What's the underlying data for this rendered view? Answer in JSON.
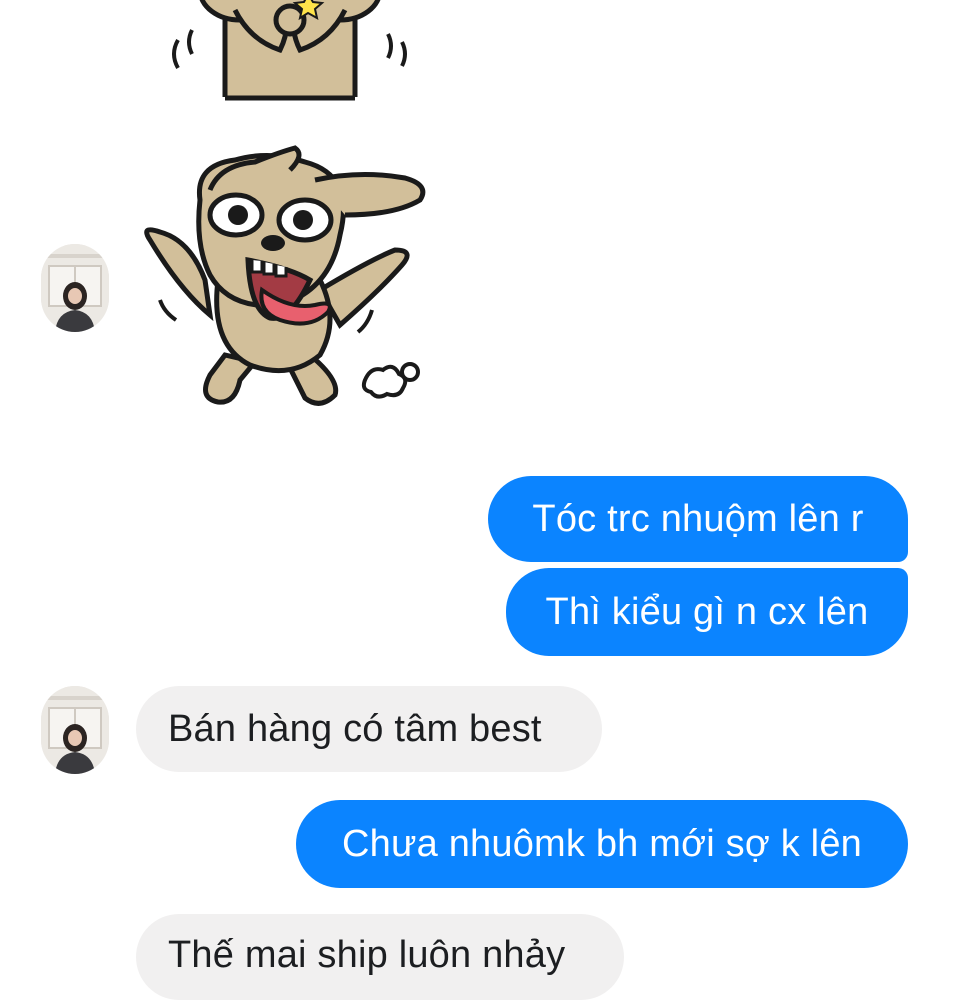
{
  "messages": [
    {
      "id": "m1",
      "direction": "outgoing",
      "text": "Tóc trc nhuộm lên r"
    },
    {
      "id": "m2",
      "direction": "outgoing",
      "text": "Thì kiểu gì n cx lên"
    },
    {
      "id": "m3",
      "direction": "incoming",
      "text": "Bán hàng có tâm best"
    },
    {
      "id": "m4",
      "direction": "outgoing",
      "text": "Chưa nhuômk bh mới sợ k lên"
    },
    {
      "id": "m5",
      "direction": "incoming",
      "text": "Thế mai ship luôn nhảy"
    }
  ],
  "stickers": [
    {
      "id": "s1",
      "icon": "dog-sticker-clasping-hands-icon"
    },
    {
      "id": "s2",
      "icon": "dog-sticker-running-tongue-out-icon"
    }
  ],
  "colors": {
    "outgoing_bubble": "#0b84ff",
    "incoming_bubble": "#f1f0f0",
    "outgoing_text": "#ffffff",
    "incoming_text": "#1c1e21",
    "sticker_fur": "#d2bf9a",
    "sticker_outline": "#1a1a1a",
    "sticker_tongue": "#e8606e"
  }
}
